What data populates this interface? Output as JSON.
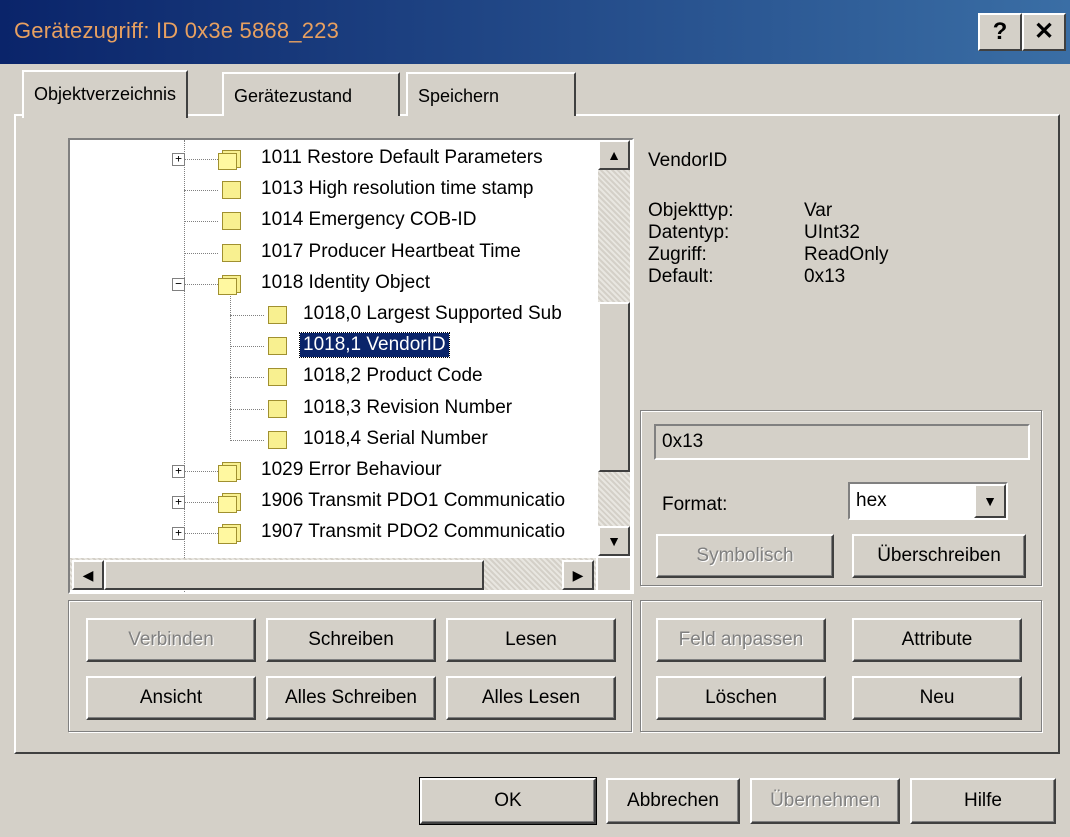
{
  "window": {
    "title": "Gerätezugriff: ID 0x3e 5868_223",
    "help_glyph": "?",
    "close_glyph": "✕"
  },
  "tabs": [
    {
      "label": "Objektverzeichnis"
    },
    {
      "label": "Gerätezustand"
    },
    {
      "label": "Speichern"
    }
  ],
  "tree": {
    "items": [
      {
        "label": "1011 Restore Default Parameters",
        "expander": "+",
        "level": 0
      },
      {
        "label": "1013 High resolution time stamp",
        "expander": "",
        "level": 0
      },
      {
        "label": "1014 Emergency COB-ID",
        "expander": "",
        "level": 0
      },
      {
        "label": "1017 Producer Heartbeat Time",
        "expander": "",
        "level": 0
      },
      {
        "label": "1018 Identity Object",
        "expander": "−",
        "level": 0
      },
      {
        "label": "1018,0 Largest Supported Sub",
        "expander": "",
        "level": 1
      },
      {
        "label": "1018,1 VendorID",
        "expander": "",
        "level": 1,
        "selected": true
      },
      {
        "label": "1018,2 Product Code",
        "expander": "",
        "level": 1
      },
      {
        "label": "1018,3 Revision Number",
        "expander": "",
        "level": 1
      },
      {
        "label": "1018,4 Serial Number",
        "expander": "",
        "level": 1
      },
      {
        "label": "1029 Error Behaviour",
        "expander": "+",
        "level": 0
      },
      {
        "label": "1906 Transmit PDO1 Communicatio",
        "expander": "+",
        "level": 0
      },
      {
        "label": "1907 Transmit PDO2 Communicatio",
        "expander": "+",
        "level": 0
      }
    ]
  },
  "info": {
    "name": "VendorID",
    "rows": [
      {
        "key": "Objekttyp:",
        "value": "Var"
      },
      {
        "key": "Datentyp:",
        "value": "UInt32"
      },
      {
        "key": "Zugriff:",
        "value": "ReadOnly"
      },
      {
        "key": "Default:",
        "value": "0x13"
      }
    ]
  },
  "value_panel": {
    "value": "0x13",
    "format_label": "Format:",
    "format_selected": "hex",
    "symbolisch": "Symbolisch",
    "ueberschreiben": "Überschreiben"
  },
  "left_buttons": {
    "verbinden": "Verbinden",
    "schreiben": "Schreiben",
    "lesen": "Lesen",
    "ansicht": "Ansicht",
    "alles_schreiben": "Alles Schreiben",
    "alles_lesen": "Alles Lesen"
  },
  "right_buttons": {
    "feld_anpassen": "Feld anpassen",
    "attribute": "Attribute",
    "loeschen": "Löschen",
    "neu": "Neu"
  },
  "footer": {
    "ok": "OK",
    "abbrechen": "Abbrechen",
    "uebernehmen": "Übernehmen",
    "hilfe": "Hilfe"
  }
}
